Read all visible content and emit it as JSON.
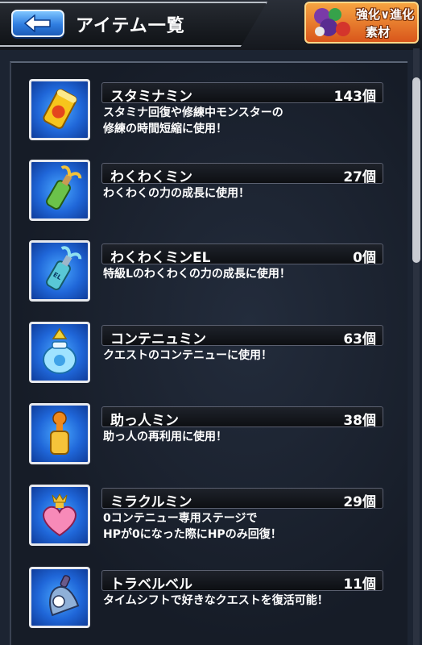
{
  "header": {
    "title": "アイテム一覧",
    "back_icon": "back-arrow-icon",
    "material_button": {
      "line1": "強化∨進化",
      "line2": "素材"
    }
  },
  "items": [
    {
      "name": "スタミナミン",
      "count": "143個",
      "desc": [
        "スタミナ回復や修練中モンスターの",
        "修練の時間短縮に使用！"
      ],
      "icon": "stamina-can-icon"
    },
    {
      "name": "わくわくミン",
      "count": "27個",
      "desc": [
        "わくわくの力の成長に使用！"
      ],
      "icon": "wakuwaku-bottle-icon"
    },
    {
      "name": "わくわくミンEL",
      "count": "0個",
      "desc": [
        "特級Lのわくわくの力の成長に使用！"
      ],
      "icon": "wakuwaku-el-bottle-icon"
    },
    {
      "name": "コンテニュミン",
      "count": "63個",
      "desc": [
        "クエストのコンテニューに使用！"
      ],
      "icon": "continue-jar-icon"
    },
    {
      "name": "助っ人ミン",
      "count": "38個",
      "desc": [
        "助っ人の再利用に使用！"
      ],
      "icon": "helper-bottle-icon"
    },
    {
      "name": "ミラクルミン",
      "count": "29個",
      "desc": [
        "0コンテニュー専用ステージで",
        "HPが0になった際にHPのみ回復！"
      ],
      "icon": "miracle-heart-icon"
    },
    {
      "name": "トラベルベル",
      "count": "11個",
      "desc": [
        "タイムシフトで好きなクエストを復活可能！"
      ],
      "icon": "travel-bell-icon"
    }
  ]
}
